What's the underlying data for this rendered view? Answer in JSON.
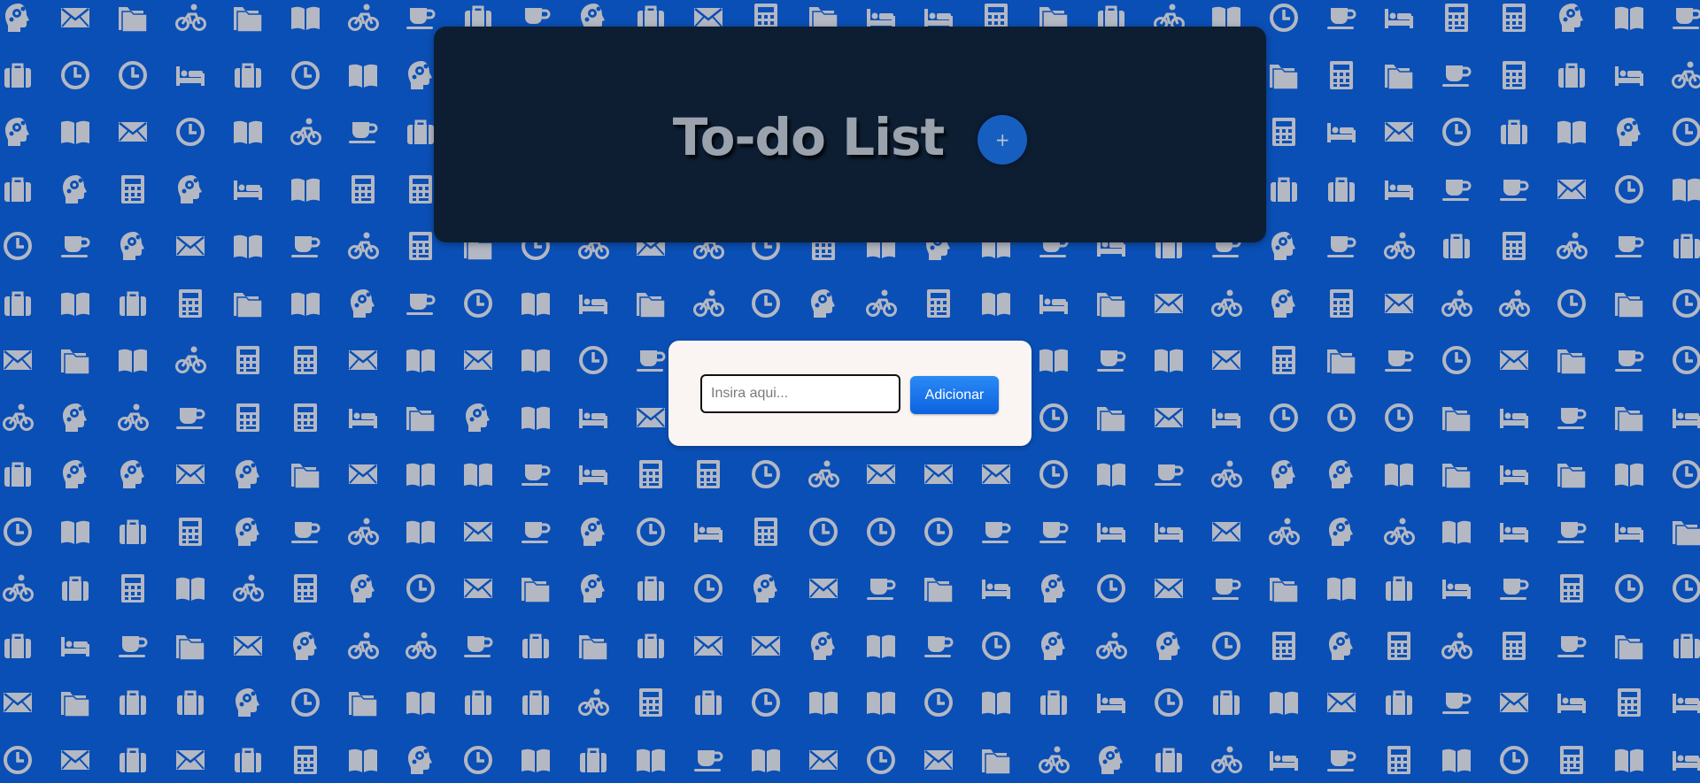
{
  "header": {
    "title": "To-do List",
    "add_toggle_label": "+"
  },
  "form": {
    "input_placeholder": "Insira aqui...",
    "input_value": "",
    "submit_label": "Adicionar"
  },
  "theme": {
    "page_background": "#0a4fb5",
    "header_background": "#0d1e33",
    "card_background": "#faf5f2",
    "button_blue": "#1877f2",
    "pattern_icon_color": "#b4b8c3"
  },
  "background_pattern": {
    "icons": [
      "clock-icon",
      "bicycle-icon",
      "folder-icon",
      "coffee-cup-icon",
      "bed-icon",
      "calculator-icon",
      "head-gears-icon",
      "book-icon",
      "briefcase-icon",
      "envelope-icon"
    ]
  }
}
